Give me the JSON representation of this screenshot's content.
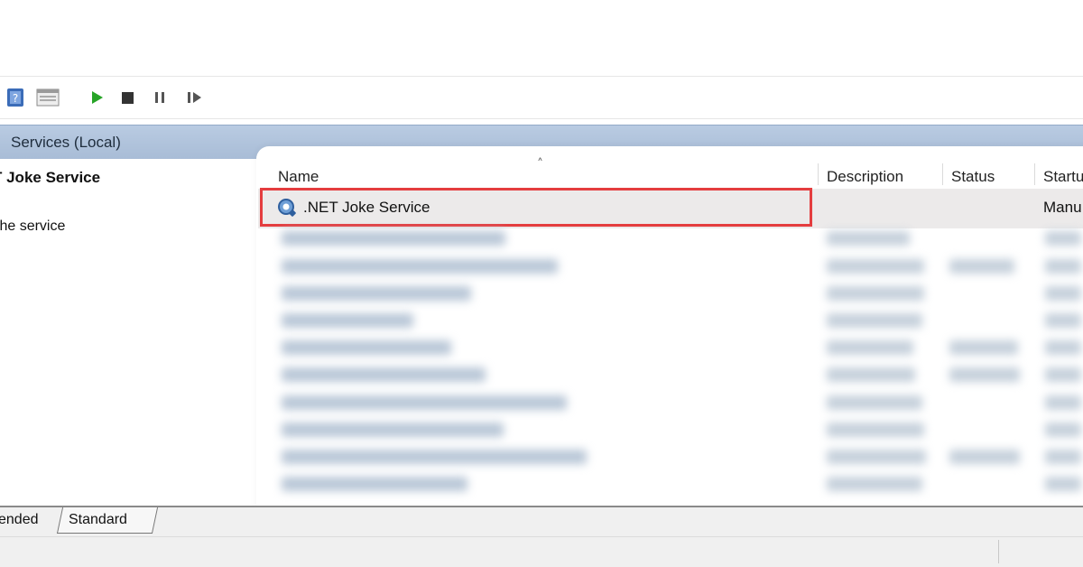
{
  "toolbar": {
    "buttons": [
      {
        "name": "help-book-icon"
      },
      {
        "name": "console-view-icon"
      },
      {
        "name": "start-icon",
        "color": "#27a427"
      },
      {
        "name": "stop-icon"
      },
      {
        "name": "pause-icon"
      },
      {
        "name": "restart-icon"
      }
    ]
  },
  "header": {
    "title": "Services (Local)"
  },
  "left_pane": {
    "service_title": "T Joke Service",
    "action_link": "the service"
  },
  "list": {
    "columns": [
      "Name",
      "Description",
      "Status",
      "Startu"
    ],
    "selected_row": {
      "name": ".NET Joke Service",
      "startup": "Manu",
      "icon": "gear-service-icon"
    }
  },
  "tabs": {
    "extended": "ended",
    "standard": "Standard"
  },
  "colors": {
    "highlight": "#e43d3f",
    "header_bar": "#b0c3dc"
  }
}
